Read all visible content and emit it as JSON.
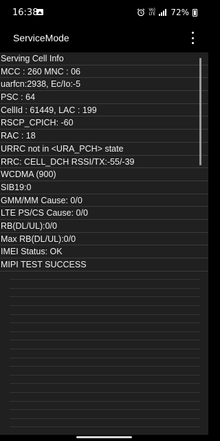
{
  "status_bar": {
    "time": "16:38",
    "net_top": "Vo)",
    "net_bottom": "LTE",
    "battery": "72%"
  },
  "app_bar": {
    "title": "ServiceMode",
    "menu_icon": "more-vert-icon"
  },
  "info_lines": [
    "Serving Cell Info",
    "MCC : 260 MNC : 06",
    "uarfcn:2938, Ec/Io:-5",
    "PSC : 64",
    "CellId : 61449, LAC : 199",
    "RSCP_CPICH: -60",
    "RAC : 18",
    "URRC not in <URA_PCH> state",
    "RRC: CELL_DCH RSSI/TX:-55/-39",
    "WCDMA (900)",
    "SIB19:0",
    "GMM/MM Cause: 0/0",
    "LTE PS/CS Cause: 0/0",
    "RB(DL/UL):0/0",
    "Max RB(DL/UL):0/0",
    "IMEI Status: OK",
    "MIPI TEST SUCCESS"
  ],
  "colors": {
    "background": "#202020",
    "text": "#f2f2f2",
    "bars": "#000000"
  }
}
